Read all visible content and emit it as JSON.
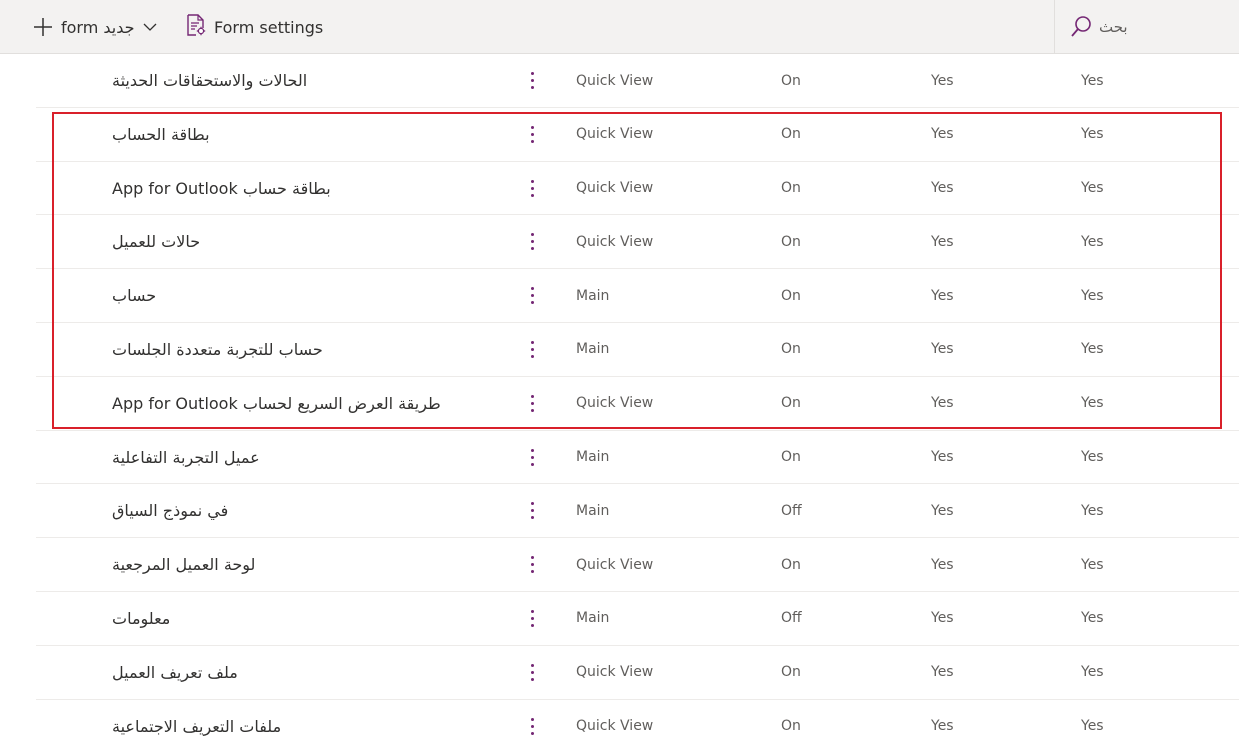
{
  "toolbar": {
    "new_form_label": "form جديد",
    "form_settings_label": "Form settings",
    "search_placeholder": "بحث"
  },
  "colors": {
    "accent": "#742774",
    "highlight_border": "#d9202a",
    "toolbar_bg": "#f3f2f1"
  },
  "rows": [
    {
      "name": "الحالات والاستحقاقات الحديثة",
      "type": "Quick View",
      "state": "On",
      "col1": "Yes",
      "col2": "Yes"
    },
    {
      "name": "بطاقة الحساب",
      "type": "Quick View",
      "state": "On",
      "col1": "Yes",
      "col2": "Yes"
    },
    {
      "name": "بطاقة حساب App for Outlook",
      "type": "Quick View",
      "state": "On",
      "col1": "Yes",
      "col2": "Yes"
    },
    {
      "name": "حالات للعميل",
      "type": "Quick View",
      "state": "On",
      "col1": "Yes",
      "col2": "Yes"
    },
    {
      "name": "حساب",
      "type": "Main",
      "state": "On",
      "col1": "Yes",
      "col2": "Yes"
    },
    {
      "name": "حساب للتجربة متعددة الجلسات",
      "type": "Main",
      "state": "On",
      "col1": "Yes",
      "col2": "Yes"
    },
    {
      "name": "طريقة العرض السريع لحساب App for Outlook",
      "type": "Quick View",
      "state": "On",
      "col1": "Yes",
      "col2": "Yes"
    },
    {
      "name": "عميل التجربة التفاعلية",
      "type": "Main",
      "state": "On",
      "col1": "Yes",
      "col2": "Yes"
    },
    {
      "name": "في نموذج السياق",
      "type": "Main",
      "state": "Off",
      "col1": "Yes",
      "col2": "Yes"
    },
    {
      "name": "لوحة العميل المرجعية",
      "type": "Quick View",
      "state": "On",
      "col1": "Yes",
      "col2": "Yes"
    },
    {
      "name": "معلومات",
      "type": "Main",
      "state": "Off",
      "col1": "Yes",
      "col2": "Yes"
    },
    {
      "name": "ملف تعريف العميل",
      "type": "Quick View",
      "state": "On",
      "col1": "Yes",
      "col2": "Yes"
    },
    {
      "name": "ملفات التعريف الاجتماعية",
      "type": "Quick View",
      "state": "On",
      "col1": "Yes",
      "col2": "Yes"
    }
  ]
}
